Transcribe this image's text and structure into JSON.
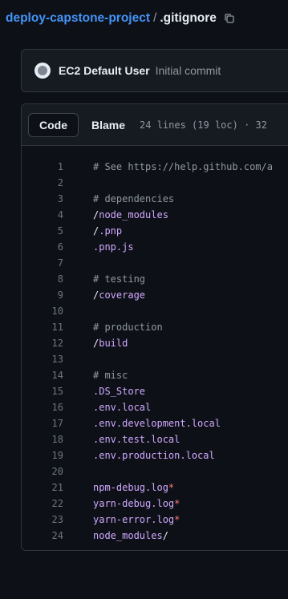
{
  "breadcrumb": {
    "repo": "deploy-capstone-project",
    "separator": "/",
    "file": ".gitignore",
    "copy_icon": "copy-icon"
  },
  "commit": {
    "avatar_icon": "github-avatar",
    "user": "EC2 Default User",
    "message": "Initial commit"
  },
  "file_header": {
    "code_tab": "Code",
    "blame_tab": "Blame",
    "stats": "24 lines (19 loc) · 32"
  },
  "colors": {
    "link": "#4493f8",
    "comment": "#9198a1",
    "path": "#d2a8ff",
    "glob_star": "#ff7b72"
  },
  "lines": [
    {
      "n": "1",
      "parts": [
        {
          "t": "# See https://help.github.com/a",
          "c": "comment"
        }
      ]
    },
    {
      "n": "2",
      "parts": []
    },
    {
      "n": "3",
      "parts": [
        {
          "t": "# dependencies",
          "c": "comment"
        }
      ]
    },
    {
      "n": "4",
      "parts": [
        {
          "t": "/",
          "c": "slash"
        },
        {
          "t": "node_modules",
          "c": "path"
        }
      ]
    },
    {
      "n": "5",
      "parts": [
        {
          "t": "/",
          "c": "slash"
        },
        {
          "t": ".pnp",
          "c": "path"
        }
      ]
    },
    {
      "n": "6",
      "parts": [
        {
          "t": ".pnp.js",
          "c": "path"
        }
      ]
    },
    {
      "n": "7",
      "parts": []
    },
    {
      "n": "8",
      "parts": [
        {
          "t": "# testing",
          "c": "comment"
        }
      ]
    },
    {
      "n": "9",
      "parts": [
        {
          "t": "/",
          "c": "slash"
        },
        {
          "t": "coverage",
          "c": "path"
        }
      ]
    },
    {
      "n": "10",
      "parts": []
    },
    {
      "n": "11",
      "parts": [
        {
          "t": "# production",
          "c": "comment"
        }
      ]
    },
    {
      "n": "12",
      "parts": [
        {
          "t": "/",
          "c": "slash"
        },
        {
          "t": "build",
          "c": "path"
        }
      ]
    },
    {
      "n": "13",
      "parts": []
    },
    {
      "n": "14",
      "parts": [
        {
          "t": "# misc",
          "c": "comment"
        }
      ]
    },
    {
      "n": "15",
      "parts": [
        {
          "t": ".DS_Store",
          "c": "path"
        }
      ]
    },
    {
      "n": "16",
      "parts": [
        {
          "t": ".env.local",
          "c": "path"
        }
      ]
    },
    {
      "n": "17",
      "parts": [
        {
          "t": ".env.development.local",
          "c": "path"
        }
      ]
    },
    {
      "n": "18",
      "parts": [
        {
          "t": ".env.test.local",
          "c": "path"
        }
      ]
    },
    {
      "n": "19",
      "parts": [
        {
          "t": ".env.production.local",
          "c": "path"
        }
      ]
    },
    {
      "n": "20",
      "parts": []
    },
    {
      "n": "21",
      "parts": [
        {
          "t": "npm-debug.log",
          "c": "path"
        },
        {
          "t": "*",
          "c": "star"
        }
      ]
    },
    {
      "n": "22",
      "parts": [
        {
          "t": "yarn-debug.log",
          "c": "path"
        },
        {
          "t": "*",
          "c": "star"
        }
      ]
    },
    {
      "n": "23",
      "parts": [
        {
          "t": "yarn-error.log",
          "c": "path"
        },
        {
          "t": "*",
          "c": "star"
        }
      ]
    },
    {
      "n": "24",
      "parts": [
        {
          "t": "node_modules",
          "c": "path"
        },
        {
          "t": "/",
          "c": "slash"
        }
      ]
    }
  ]
}
